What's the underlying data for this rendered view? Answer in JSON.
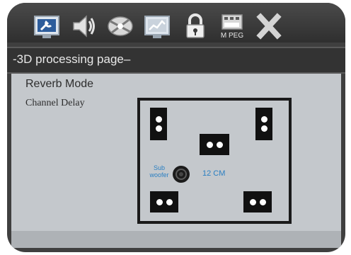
{
  "toolbar": {
    "icons": [
      "settings-icon",
      "speaker-icon",
      "satellite-icon",
      "display-icon",
      "lock-icon",
      "mpeg-icon",
      "close-icon"
    ],
    "mpeg_label": "M PEG"
  },
  "page": {
    "title": "-3D processing page–"
  },
  "menu": {
    "reverb_mode": "Reverb Mode",
    "channel_delay": "Channel Delay"
  },
  "diagram": {
    "sub_line1": "Sub",
    "sub_line2": "woofer",
    "delay_value": "12 CM"
  },
  "colors": {
    "frame": "#3f3f3f",
    "content_bg": "#c4c8cc",
    "accent_text": "#2a7fc2"
  }
}
